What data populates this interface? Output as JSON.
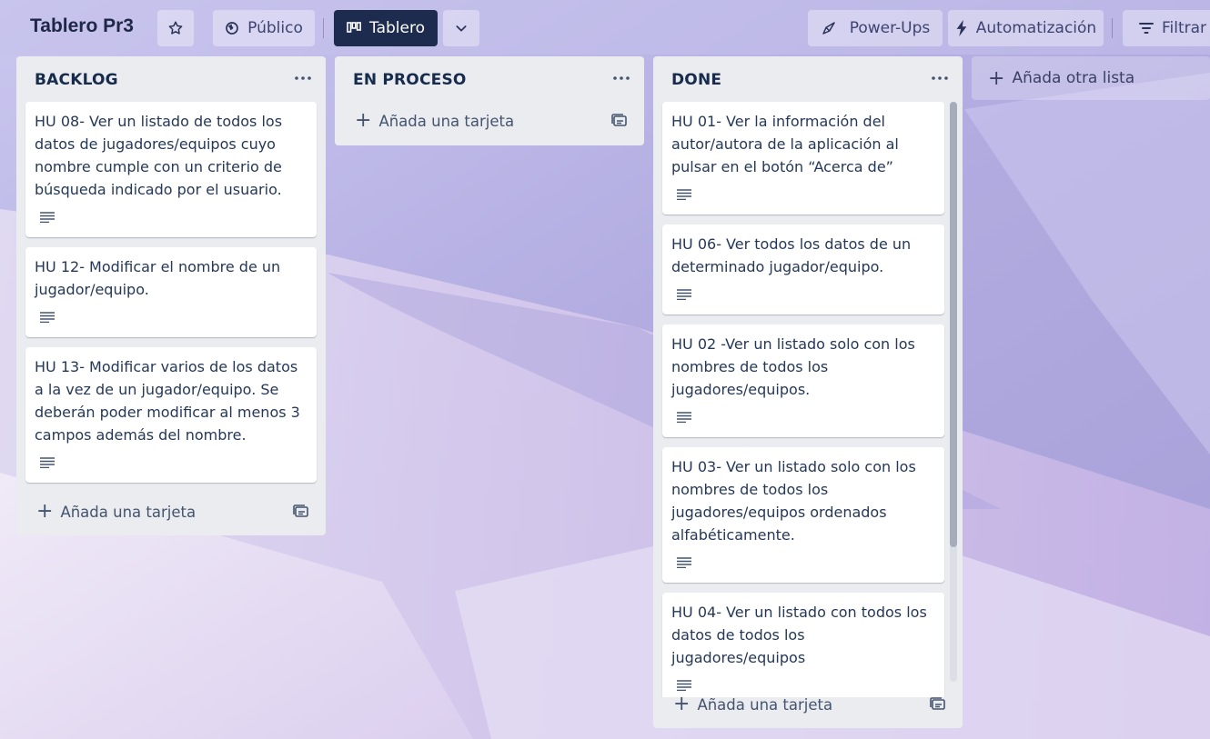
{
  "header": {
    "board_title": "Tablero Pr3",
    "visibility_label": "Público",
    "view_label": "Tablero",
    "powerups_label": "Power-Ups",
    "automation_label": "Automatización",
    "filter_label": "Filtrar"
  },
  "lists": [
    {
      "title": "BACKLOG",
      "cards": [
        {
          "text": "HU 08- Ver un listado de todos los datos de jugadores/equipos cuyo nombre cumple con un criterio de búsqueda indicado por el usuario."
        },
        {
          "text": "HU 12- Modificar el nombre de un jugador/equipo."
        },
        {
          "text": "HU 13- Modificar varios de los datos a la vez de un jugador/equipo. Se deberán poder modificar al menos 3 campos además del nombre."
        }
      ],
      "add_card_label": "Añada una tarjeta"
    },
    {
      "title": "EN PROCESO",
      "cards": [],
      "add_card_label": "Añada una tarjeta"
    },
    {
      "title": "DONE",
      "cards": [
        {
          "text": "HU 01- Ver la información del autor/autora de la aplicación al pulsar en el botón “Acerca de”"
        },
        {
          "text": "HU 06- Ver todos los datos de un determinado jugador/equipo."
        },
        {
          "text": "HU 02 -Ver un listado solo con los nombres de todos los jugadores/equipos."
        },
        {
          "text": "HU 03- Ver un listado solo con los nombres de todos los jugadores/equipos ordenados alfabéticamente."
        },
        {
          "text": "HU 04- Ver un listado con todos los datos de todos los jugadores/equipos"
        }
      ],
      "add_card_label": "Añada una tarjeta"
    }
  ],
  "add_list_label": "Añada otra lista",
  "colors": {
    "list_bg": "#ebecf0",
    "card_bg": "#ffffff",
    "view_button_bg": "#1d2b4f",
    "board_bg": "#b9b3e3"
  }
}
